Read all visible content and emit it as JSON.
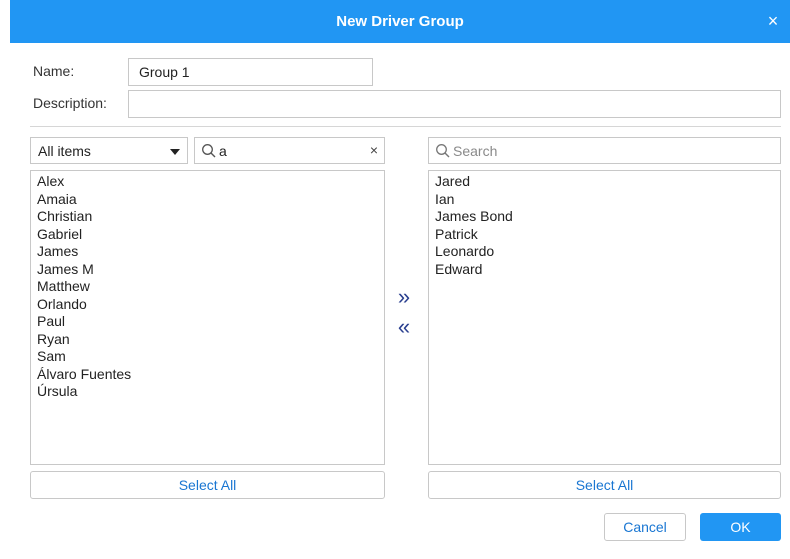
{
  "dialog": {
    "title": "New Driver Group",
    "close_glyph": "×"
  },
  "form": {
    "name_label": "Name:",
    "name_value": "Group 1",
    "description_label": "Description:",
    "description_value": ""
  },
  "left_panel": {
    "filter_selected": "All items",
    "search_value": "a",
    "clear_glyph": "×",
    "items": [
      "Alex",
      "Amaia",
      "Christian",
      "Gabriel",
      "James",
      "James M",
      "Matthew",
      "Orlando",
      "Paul",
      "Ryan",
      "Sam",
      "Álvaro Fuentes",
      "Úrsula"
    ],
    "select_all_label": "Select All"
  },
  "transfer": {
    "add_glyph": "»",
    "remove_glyph": "«"
  },
  "right_panel": {
    "search_placeholder": "Search",
    "items": [
      "Jared",
      "Ian",
      "James Bond",
      "Patrick",
      "Leonardo",
      "Edward"
    ],
    "select_all_label": "Select All"
  },
  "footer": {
    "cancel_label": "Cancel",
    "ok_label": "OK"
  },
  "icons": {
    "close": "close-icon",
    "search": "search-icon",
    "dropdown": "chevron-down-icon",
    "clear": "clear-icon"
  },
  "colors": {
    "accent": "#2196f3",
    "link": "#1976d2",
    "border": "#c8c8c8"
  }
}
